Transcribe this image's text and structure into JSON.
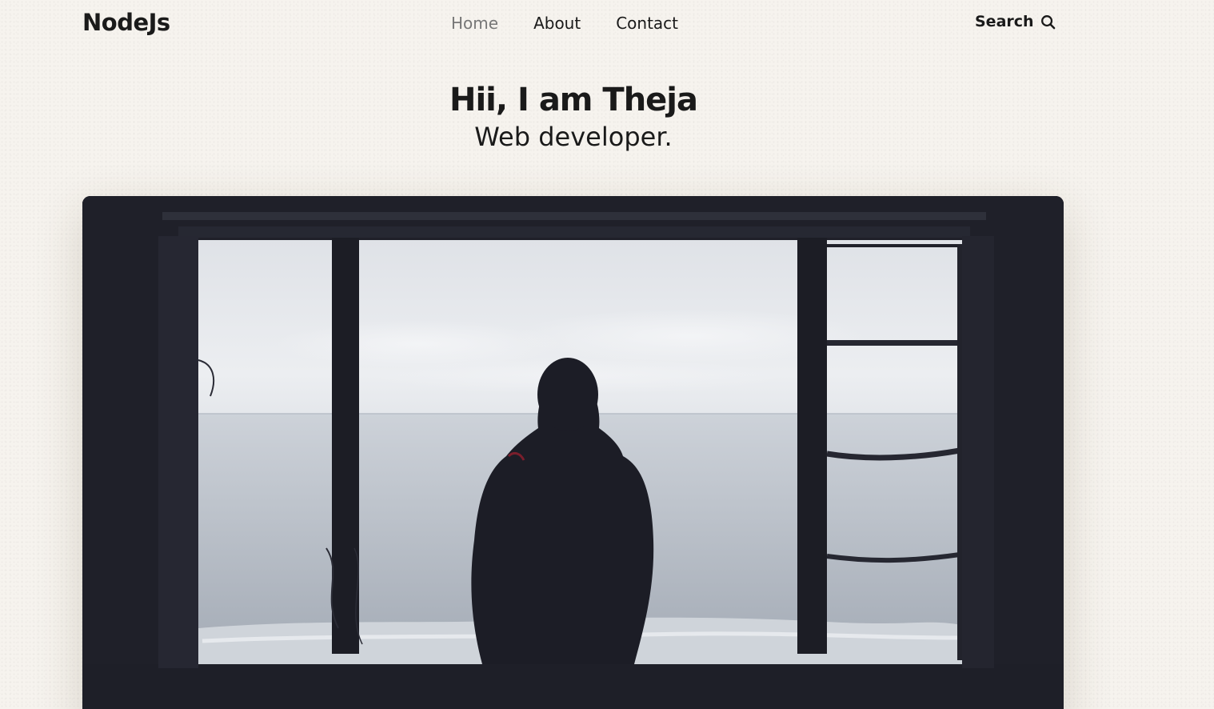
{
  "header": {
    "logo": "NodeJs",
    "nav": [
      {
        "label": "Home",
        "active": true
      },
      {
        "label": "About",
        "active": false
      },
      {
        "label": "Contact",
        "active": false
      }
    ],
    "search_label": "Search",
    "search_icon": "search-icon"
  },
  "hero": {
    "title": "Hii, I am Theja",
    "subtitle": "Web developer."
  },
  "colors": {
    "background": "#f6f3ee",
    "text": "#1a1a1a",
    "nav_active": "#777777",
    "image_frame": "#20212a"
  }
}
